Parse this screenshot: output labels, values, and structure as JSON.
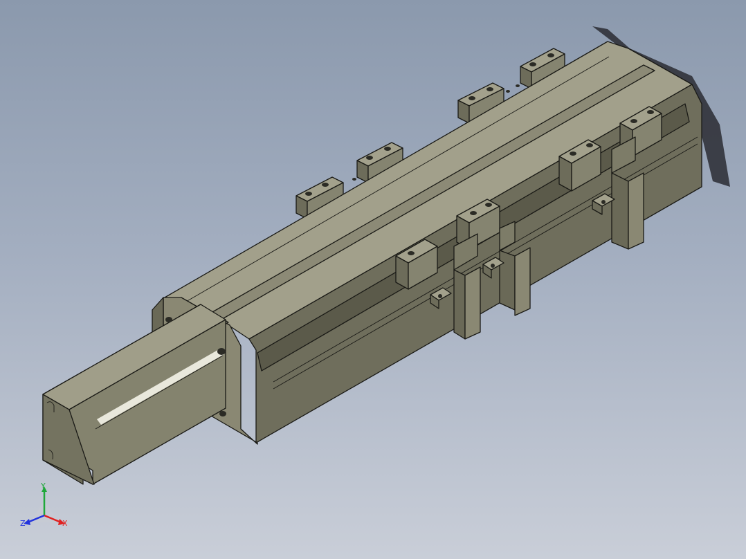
{
  "viewport": {
    "background_top": "#8b99ad",
    "background_bottom": "#c9ced8",
    "model_color": "#7c7b67"
  },
  "triad": {
    "x_label": "X",
    "y_label": "Y",
    "z_label": "Z",
    "x_color": "#e02020",
    "y_color": "#1fa83a",
    "z_color": "#2233dd"
  }
}
